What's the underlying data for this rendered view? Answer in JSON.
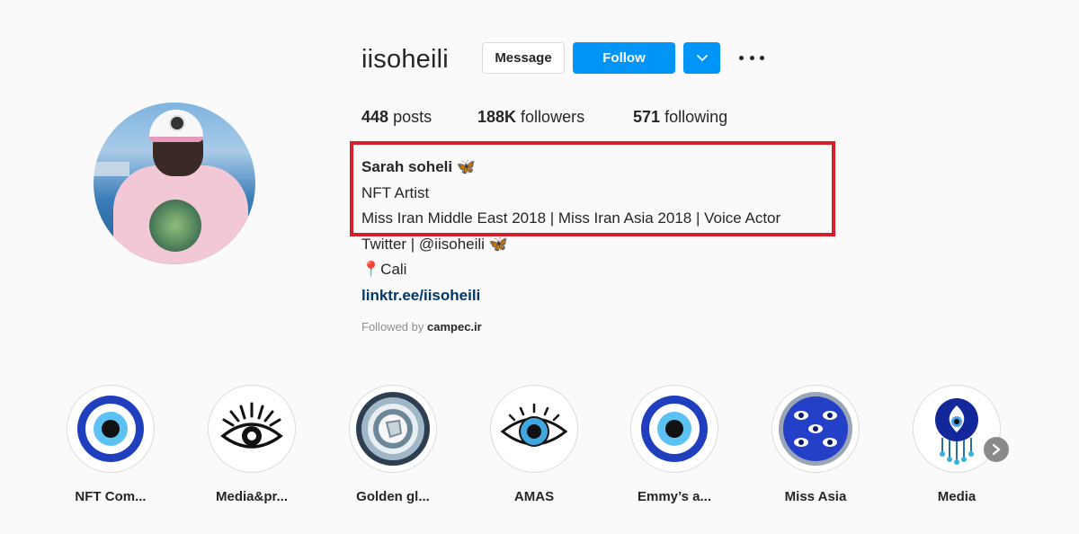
{
  "profile": {
    "username": "iisoheili",
    "message_label": "Message",
    "follow_label": "Follow",
    "dropdown_icon": "chevron-down-icon",
    "more_icon": "more-options-icon"
  },
  "stats": [
    {
      "value": "448",
      "label": "posts"
    },
    {
      "value": "188K",
      "label": "followers"
    },
    {
      "value": "571",
      "label": "following"
    }
  ],
  "bio": {
    "name": "Sarah soheli 🦋",
    "category": "NFT Artist",
    "line1": "Miss Iran Middle East 2018 | Miss Iran Asia 2018 | Voice Actor",
    "line2": "Twitter | @iisoheili 🦋",
    "line3": "📍Cali",
    "link": "linktr.ee/iisoheili"
  },
  "followed_by": {
    "prefix": "Followed by",
    "user": "campec.ir"
  },
  "highlights": [
    {
      "label": "NFT Com...",
      "icon": "evil-eye-icon"
    },
    {
      "label": "Media&pr...",
      "icon": "eye-rays-icon"
    },
    {
      "label": "Golden gl...",
      "icon": "agate-icon"
    },
    {
      "label": "AMAS",
      "icon": "eye-lashes-icon"
    },
    {
      "label": "Emmy’s a...",
      "icon": "evil-eye-icon"
    },
    {
      "label": "Miss Asia",
      "icon": "eye-pattern-icon"
    },
    {
      "label": "Media",
      "icon": "evil-eye-charm-icon"
    }
  ],
  "colors": {
    "follow_blue": "#0095f6",
    "highlight_red": "#d3202a",
    "link_blue": "#00376b",
    "evil_eye_blue": "#1f3fbf"
  }
}
